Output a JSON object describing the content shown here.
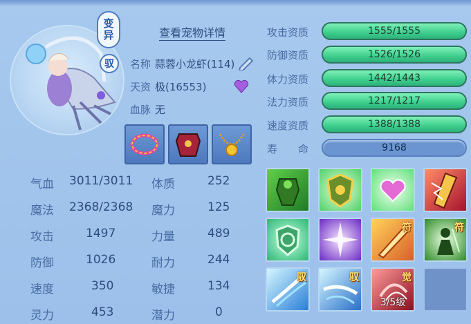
{
  "header": {
    "top_left": "",
    "top_right": ""
  },
  "pet": {
    "badge_bianyi": "变异",
    "badge_yu": "驭",
    "detail_link": "查看宠物详情",
    "name_label": "名称",
    "name_value": "蒜蓉小龙虾(114)",
    "talent_label": "天资",
    "talent_value": "极(16553)",
    "blood_label": "血脉",
    "blood_value": "无"
  },
  "equipment": [
    {
      "icon": "ring-icon"
    },
    {
      "icon": "armor-icon"
    },
    {
      "icon": "necklace-icon"
    }
  ],
  "stats": [
    {
      "label": "气血",
      "value": "3011/3011",
      "label2": "体质",
      "value2": "252"
    },
    {
      "label": "魔法",
      "value": "2368/2368",
      "label2": "魔力",
      "value2": "125"
    },
    {
      "label": "攻击",
      "value": "1497",
      "label2": "力量",
      "value2": "489"
    },
    {
      "label": "防御",
      "value": "1026",
      "label2": "耐力",
      "value2": "244"
    },
    {
      "label": "速度",
      "value": "350",
      "label2": "敏捷",
      "value2": "134"
    },
    {
      "label": "灵力",
      "value": "453",
      "label2": "潜力",
      "value2": "0"
    }
  ],
  "qualities": [
    {
      "label": "攻击资质",
      "text": "1555/1555",
      "fill": 1.0
    },
    {
      "label": "防御资质",
      "text": "1526/1526",
      "fill": 1.0
    },
    {
      "label": "体力资质",
      "text": "1442/1443",
      "fill": 0.999
    },
    {
      "label": "法力资质",
      "text": "1217/1217",
      "fill": 1.0
    },
    {
      "label": "速度资质",
      "text": "1388/1388",
      "fill": 1.0
    }
  ],
  "lifespan": {
    "label": "寿　　命",
    "value": "9168"
  },
  "skills": [
    {
      "icon": "strength-icon",
      "tag": "",
      "level": ""
    },
    {
      "icon": "shield-icon",
      "tag": "",
      "level": ""
    },
    {
      "icon": "heart-icon",
      "tag": "",
      "level": ""
    },
    {
      "icon": "lightning-blade-icon",
      "tag": "",
      "level": ""
    },
    {
      "icon": "defense-shield-icon",
      "tag": "",
      "level": ""
    },
    {
      "icon": "burst-icon",
      "tag": "",
      "level": ""
    },
    {
      "icon": "fire-sword-icon",
      "tag": "符",
      "level": ""
    },
    {
      "icon": "warrior-icon",
      "tag": "符",
      "level": ""
    },
    {
      "icon": "ice-slash-icon",
      "tag": "驭",
      "level": ""
    },
    {
      "icon": "ice-slash2-icon",
      "tag": "驭",
      "level": ""
    },
    {
      "icon": "awaken-claw-icon",
      "tag": "觉",
      "level": "3/5级"
    },
    {
      "icon": "empty-slot",
      "tag": "",
      "level": ""
    }
  ],
  "colors": {
    "background": "#9cc0ea",
    "bar_fill": "#3fce8d",
    "text": "#2f4d7f"
  }
}
